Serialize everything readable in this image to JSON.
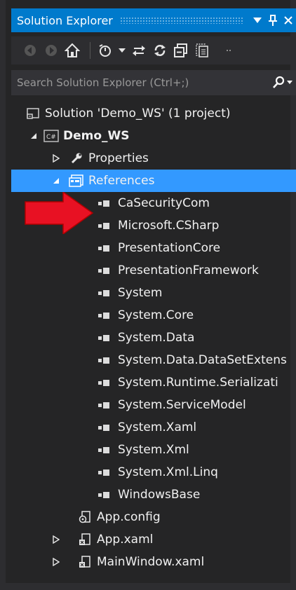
{
  "window": {
    "title": "Solution Explorer"
  },
  "title_buttons": {
    "dropdown": "▼",
    "pin": "ꟼ",
    "close": "✕"
  },
  "search": {
    "placeholder": "Search Solution Explorer (Ctrl+;)"
  },
  "toolbar": {
    "icons": [
      "back-icon",
      "forward-icon",
      "home-icon",
      "pending-changes-icon",
      "dropdown-icon",
      "sync-icon",
      "refresh-icon",
      "collapse-all-icon",
      "show-all-files-icon"
    ]
  },
  "tree": {
    "solution": "Solution 'Demo_WS' (1 project)",
    "project": "Demo_WS",
    "properties": "Properties",
    "references": "References",
    "reference_items": [
      "CaSecurityCom",
      "Microsoft.CSharp",
      "PresentationCore",
      "PresentationFramework",
      "System",
      "System.Core",
      "System.Data",
      "System.Data.DataSetExtens",
      "System.Runtime.Serializati",
      "System.ServiceModel",
      "System.Xaml",
      "System.Xml",
      "System.Xml.Linq",
      "WindowsBase"
    ],
    "app_config": "App.config",
    "app_xaml": "App.xaml",
    "main_window": "MainWindow.xaml"
  },
  "colors": {
    "accent": "#007acc",
    "selection": "#3399ff",
    "background": "#252526",
    "callout": "#e81123"
  }
}
